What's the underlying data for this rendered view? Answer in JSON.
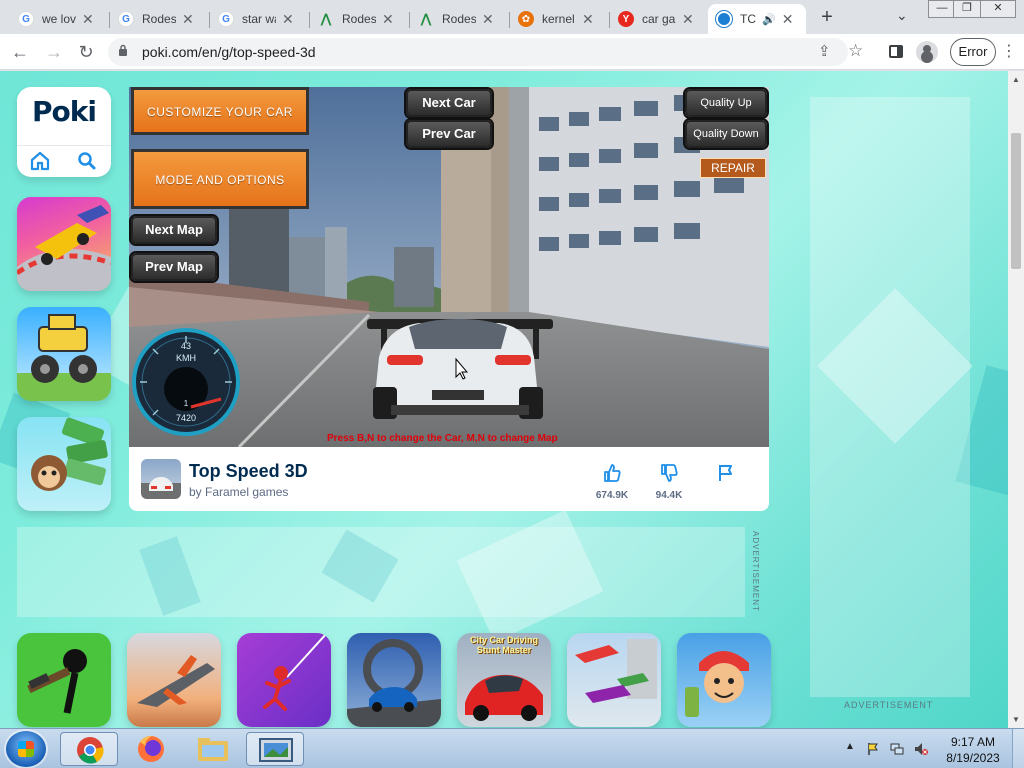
{
  "tabs": [
    {
      "title": "we lov",
      "favicon": "google-icon"
    },
    {
      "title": "Rodes",
      "favicon": "google-icon"
    },
    {
      "title": "star wa",
      "favicon": "google-icon"
    },
    {
      "title": "Rodes",
      "favicon": "appsheet-icon"
    },
    {
      "title": "Rodes",
      "favicon": "appsheet-icon"
    },
    {
      "title": "kernel",
      "favicon": "flower-icon"
    },
    {
      "title": "car ga",
      "favicon": "yandex-icon"
    },
    {
      "title": "TC",
      "favicon": "poki-icon",
      "active": true,
      "audio": true
    }
  ],
  "window_controls": {
    "minimize": "—",
    "maximize": "❐",
    "close": "✕"
  },
  "address_bar": {
    "url": "poki.com/en/g/top-speed-3d",
    "error_button": "Error"
  },
  "site": {
    "logo": "Poki"
  },
  "game": {
    "buttons": {
      "customize": "CUSTOMIZE YOUR CAR",
      "mode": "MODE AND OPTIONS",
      "next_car": "Next Car",
      "prev_car": "Prev Car",
      "quality_up": "Quality Up",
      "quality_down": "Quality Down",
      "repair": "REPAIR",
      "next_map": "Next Map",
      "prev_map": "Prev Map"
    },
    "hint": "Press B,N to change the Car, M,N to change Map",
    "speedometer": {
      "speed": "43",
      "unit": "KMH",
      "gear": "1",
      "rpm": "7420"
    }
  },
  "game_info": {
    "title": "Top Speed 3D",
    "developer": "by Faramel games",
    "likes": "674.9K",
    "dislikes": "94.4K"
  },
  "ads": {
    "vertical_label": "ADVERTISEMENT",
    "horizontal_label": "ADVERTISEMENT"
  },
  "related_games": [
    {
      "name": "stickman-shooter-game"
    },
    {
      "name": "jet-fighter-game"
    },
    {
      "name": "stickman-swing-game"
    },
    {
      "name": "car-stunt-loop-game"
    },
    {
      "name": "city-car-driving-stunt-master",
      "label": "City Car Driving Stunt Master"
    },
    {
      "name": "flying-car-game"
    },
    {
      "name": "subway-surfers-game"
    }
  ],
  "taskbar": {
    "apps": [
      "chrome",
      "firefox",
      "file-explorer",
      "image-viewer"
    ],
    "time": "9:17 AM",
    "date": "8/19/2023"
  },
  "colors": {
    "accent_teal": "#6fe6d7",
    "poki_navy": "#002b50",
    "game_orange": "#f0892e",
    "like_blue": "#1f8fe8"
  }
}
